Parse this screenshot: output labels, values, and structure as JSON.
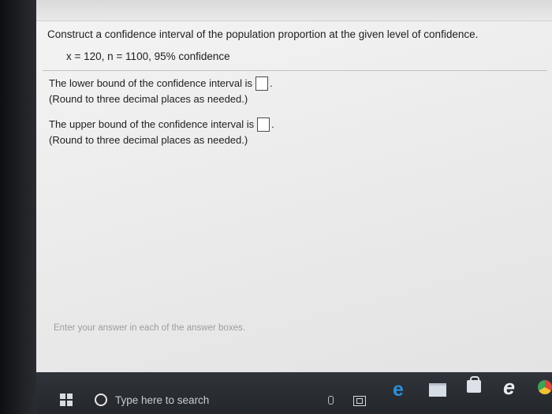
{
  "question": {
    "prompt": "Construct a confidence interval of the population proportion at the given level of confidence.",
    "given": "x = 120, n = 1100, 95% confidence"
  },
  "answers": [
    {
      "label": "The lower bound of the confidence interval is",
      "hint": "(Round to three decimal places as needed.)",
      "value": ""
    },
    {
      "label": "The upper bound of the confidence interval is",
      "hint": "(Round to three decimal places as needed.)",
      "value": ""
    }
  ],
  "period": ".",
  "instruction": "Enter your answer in each of the answer boxes.",
  "taskbar": {
    "search_placeholder": "Type here to search",
    "icons": [
      "windows-start-icon",
      "cortana-icon",
      "microphone-icon",
      "task-view-icon",
      "edge-icon",
      "file-explorer-icon",
      "store-icon",
      "internet-explorer-icon",
      "chrome-icon"
    ]
  },
  "colors": {
    "page_background": "#ececec",
    "taskbar": "#2b2e33",
    "edge_blue": "#2e8fd8",
    "instruction_text": "#9c9c9c"
  }
}
